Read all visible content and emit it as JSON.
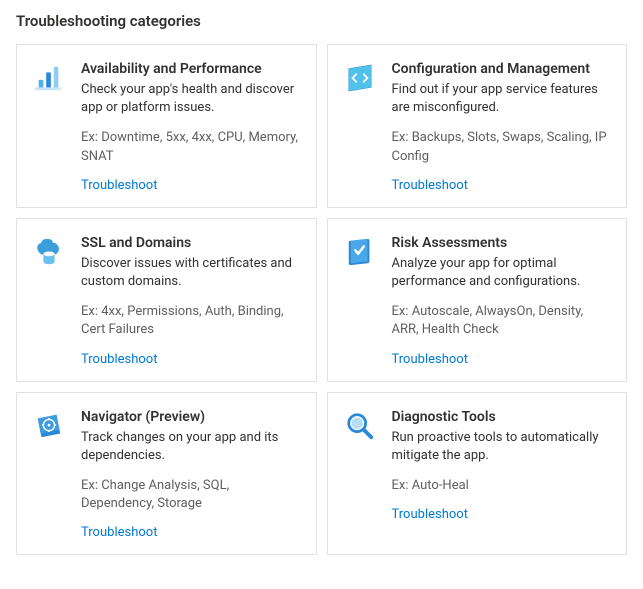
{
  "section_title": "Troubleshooting categories",
  "link_label": "Troubleshoot",
  "cards": [
    {
      "title": "Availability and Performance",
      "desc": "Check your app's health and discover app or platform issues.",
      "ex": "Ex: Downtime, 5xx, 4xx, CPU, Memory, SNAT",
      "icon": "bar-chart-icon"
    },
    {
      "title": "Configuration and Management",
      "desc": "Find out if your app service features are misconfigured.",
      "ex": "Ex: Backups, Slots, Swaps, Scaling, IP Config",
      "icon": "code-icon"
    },
    {
      "title": "SSL and Domains",
      "desc": "Discover issues with certificates and custom domains.",
      "ex": "Ex: 4xx, Permissions, Auth, Binding, Cert Failures",
      "icon": "database-icon"
    },
    {
      "title": "Risk Assessments",
      "desc": "Analyze your app for optimal performance and configurations.",
      "ex": "Ex: Autoscale, AlwaysOn, Density, ARR, Health Check",
      "icon": "book-icon"
    },
    {
      "title": "Navigator (Preview)",
      "desc": "Track changes on your app and its dependencies.",
      "ex": "Ex: Change Analysis, SQL, Dependency, Storage",
      "icon": "compass-icon"
    },
    {
      "title": "Diagnostic Tools",
      "desc": "Run proactive tools to automatically mitigate the app.",
      "ex": "Ex: Auto-Heal",
      "icon": "magnifier-icon"
    }
  ]
}
